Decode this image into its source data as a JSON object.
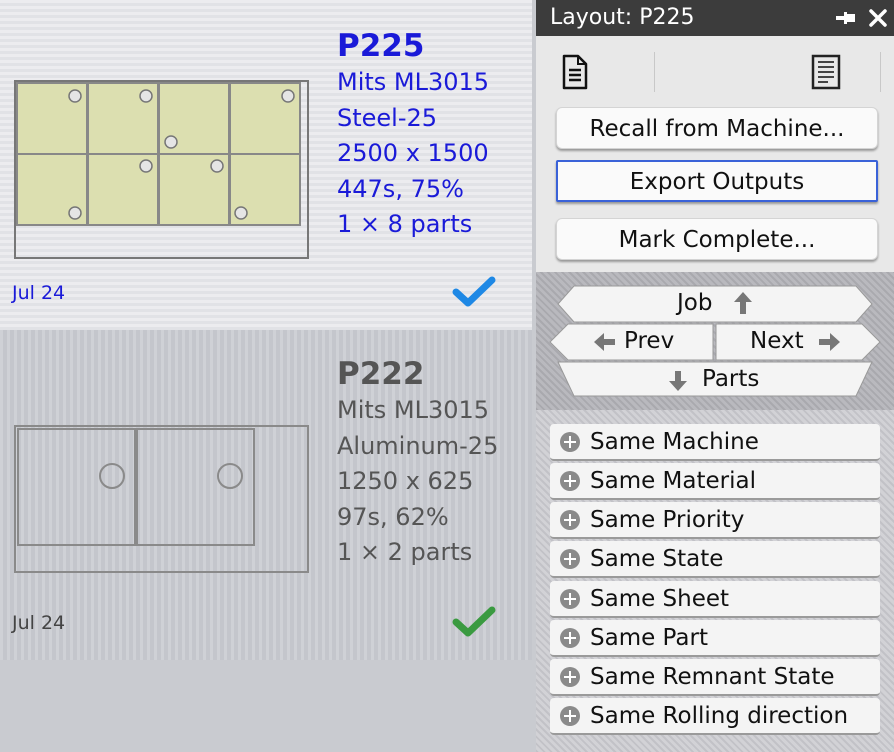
{
  "layouts": [
    {
      "name": "P225",
      "machine": "Mits ML3015",
      "material": "Steel-25",
      "sheet_size": "2500 x 1500",
      "time_util": "447s, 75%",
      "parts": "1 × 8 parts",
      "date": "Jul 24",
      "status": "selected",
      "check_color": "#1e88e5",
      "text_color": "#1a1ad8"
    },
    {
      "name": "P222",
      "machine": "Mits ML3015",
      "material": "Aluminum-25",
      "sheet_size": "1250 x 625",
      "time_util": "97s, 62%",
      "parts": "1 × 2 parts",
      "date": "Jul 24",
      "status": "complete",
      "check_color": "#3a9a40",
      "text_color": "#555555"
    }
  ],
  "panel": {
    "title": "Layout: P225",
    "toolbar_icons": [
      "document-icon",
      "report-icon"
    ],
    "buttons": {
      "recall": "Recall from Machine...",
      "export": "Export Outputs",
      "mark_complete": "Mark Complete..."
    },
    "nav": {
      "job": "Job",
      "prev": "Prev",
      "next": "Next",
      "parts": "Parts"
    },
    "filters": [
      "Same Machine",
      "Same Material",
      "Same Priority",
      "Same State",
      "Same Sheet",
      "Same Part",
      "Same Remnant State",
      "Same Rolling direction"
    ]
  }
}
